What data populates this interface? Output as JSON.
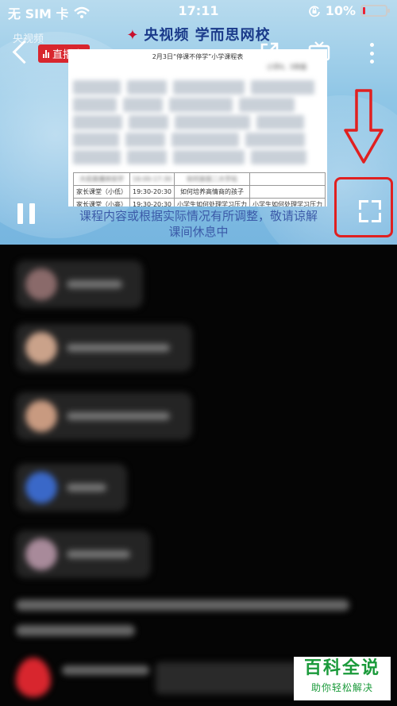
{
  "status_bar": {
    "carrier": "无 SIM 卡",
    "time": "17:11",
    "battery_percent": "10%",
    "battery_level": 0.1,
    "icons": [
      "wifi-icon",
      "orientation-lock-icon",
      "battery-icon"
    ]
  },
  "player": {
    "brand_header": "央视频  学而思网校",
    "watermark_brand": "央视频",
    "live_badge": "直播中",
    "notice_line1": "课程内容或根据实际情况有所调整，敬请谅解",
    "notice_line2": "课间休息中",
    "icons": [
      "back-icon",
      "share-icon",
      "tv-cast-icon",
      "more-icon",
      "pause-icon",
      "fullscreen-icon"
    ],
    "schedule": {
      "title": "2月3日“停课不停学”小学课程表",
      "column_header": "小学4、5年级",
      "rows": [
        [
          "大班直播体验学",
          "16:00-17:30",
          "如何家庭二大学玩",
          ""
        ],
        [
          "家长课堂（小低）",
          "19:30-20:30",
          "如何培养高情商的孩子",
          ""
        ],
        [
          "家长课堂（小高）",
          "19:30-20:30",
          "小学生如何处理学习压力",
          "小学生如何处理学习压力"
        ]
      ]
    }
  },
  "annotation": {
    "color": "#e02020",
    "target": "fullscreen-icon"
  },
  "watermark": {
    "main": "百科全说",
    "sub": "助你轻松解决",
    "color": "#1a9a3a"
  }
}
